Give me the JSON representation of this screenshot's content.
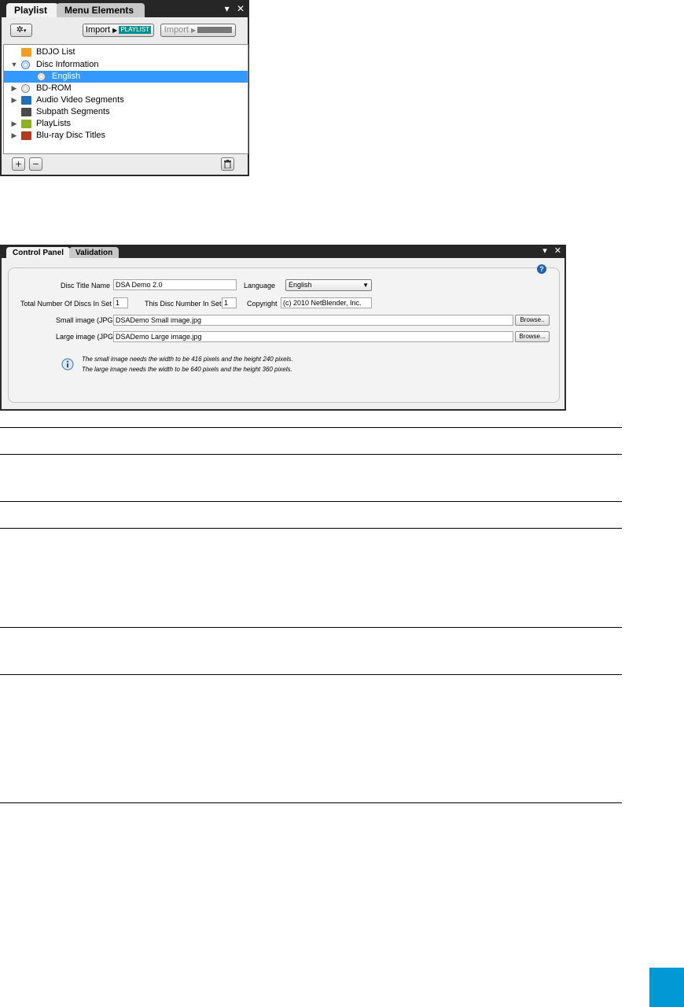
{
  "playlist_panel": {
    "tabs": [
      {
        "label": "Playlist",
        "active": true
      },
      {
        "label": "Menu Elements",
        "active": false
      }
    ],
    "window_controls": {
      "menu": "▾",
      "close": "✕"
    },
    "toolbar": {
      "gear_icon": "gear-icon",
      "import_button_1": {
        "label": "Import",
        "badge": "PLAYLIST",
        "badge_color": "#0a8f8f"
      },
      "import_button_2": {
        "label": "Import",
        "badge": "",
        "badge_color": "#777777"
      }
    },
    "tree": [
      {
        "label": "BDJO List",
        "level": 1,
        "expander": "",
        "icon": "folder-icon",
        "icon_color": "#f0a020",
        "selected": false
      },
      {
        "label": "Disc Information",
        "level": 0,
        "expander": "▼",
        "icon": "magnifier-icon",
        "icon_color": "#3a7bd5",
        "selected": false
      },
      {
        "label": "English",
        "level": 2,
        "expander": "",
        "icon": "disc-icon",
        "icon_color": "#cccccc",
        "selected": true
      },
      {
        "label": "BD-ROM",
        "level": 0,
        "expander": "▶",
        "icon": "disc-icon",
        "icon_color": "#cccccc",
        "selected": false
      },
      {
        "label": "Audio Video Segments",
        "level": 0,
        "expander": "▶",
        "icon": "folder-icon",
        "icon_color": "#1e6fb8",
        "selected": false
      },
      {
        "label": "Subpath Segments",
        "level": 1,
        "expander": "",
        "icon": "folder-icon",
        "icon_color": "#4a4a4a",
        "selected": false
      },
      {
        "label": "PlayLists",
        "level": 0,
        "expander": "▶",
        "icon": "folder-icon",
        "icon_color": "#8fb020",
        "selected": false
      },
      {
        "label": "Blu-ray Disc Titles",
        "level": 0,
        "expander": "▶",
        "icon": "folder-icon",
        "icon_color": "#b03a1e",
        "selected": false
      }
    ],
    "bottom_buttons": {
      "add": "+",
      "remove": "−",
      "trash_icon": "trash-icon"
    }
  },
  "control_panel": {
    "tabs": [
      {
        "label": "Control Panel",
        "active": true
      },
      {
        "label": "Validation",
        "active": false
      }
    ],
    "window_controls": {
      "menu": "▾",
      "close": "✕"
    },
    "help_icon": "help-icon",
    "disc_title_name": {
      "label": "Disc Title Name",
      "value": "DSA Demo 2.0"
    },
    "language": {
      "label": "Language",
      "value": "English"
    },
    "total_discs": {
      "label": "Total Number Of Discs In Set",
      "value": "1"
    },
    "this_disc": {
      "label": "This Disc Number In Set",
      "value": "1"
    },
    "copyright": {
      "label": "Copyright",
      "value": "(c) 2010 NetBlender, Inc."
    },
    "small_image": {
      "label": "Small image (JPG)",
      "value": "DSADemo Small image.jpg",
      "browse": "Browse.."
    },
    "large_image": {
      "label": "Large image (JPG)",
      "value": "DSADemo Large image.jpg",
      "browse": "Browse..."
    },
    "info": {
      "icon": "info-icon",
      "line1": "The small image needs the width to be 416 pixels and the height  240 pixels.",
      "line2": "The large image needs the width to be 640 pixels and the height 360  pixels."
    }
  },
  "colors": {
    "accent_block": "#0099d6",
    "selection": "#3399ff"
  }
}
